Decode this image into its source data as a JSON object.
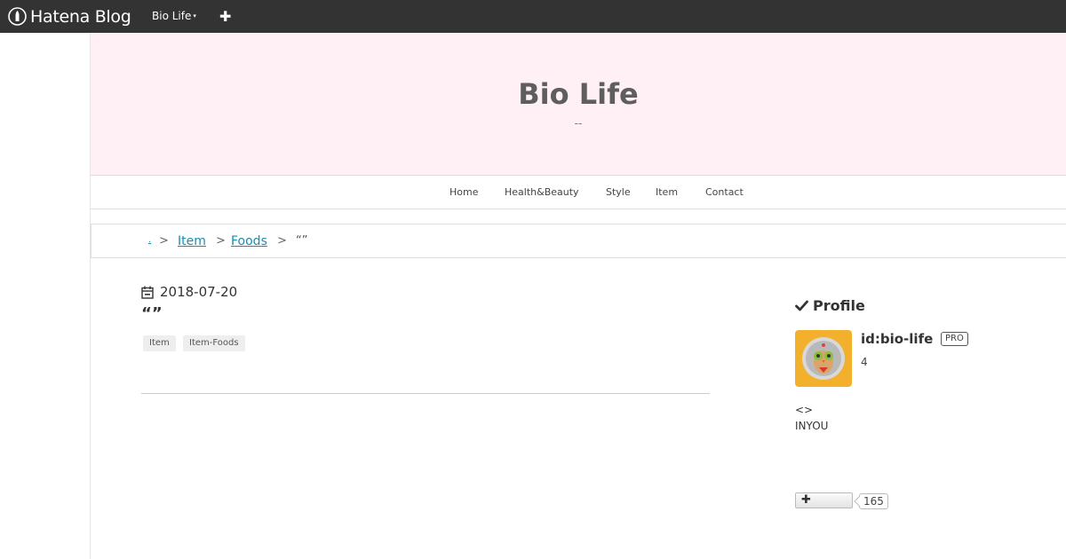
{
  "topbar": {
    "logo_text": "Hatena Blog",
    "blog_switch_label": "Bio Life",
    "caret": "▾",
    "add_label": "✚"
  },
  "header": {
    "title": "Bio Life",
    "description": "--"
  },
  "nav": {
    "items": [
      "Home",
      "Health&Beauty",
      "Style",
      "Item",
      "Contact"
    ]
  },
  "breadcrumb": {
    "home": ".",
    "sep": ">",
    "item": "Item",
    "foods": "Foods",
    "current": "“”"
  },
  "entry": {
    "date": "2018-07-20",
    "title": "“”",
    "tags": [
      "Item",
      "Item-Foods"
    ]
  },
  "profile": {
    "heading": "Profile",
    "id": "id:bio-life",
    "badge": "PRO",
    "count": "4",
    "desc1": "<>",
    "desc2": "INYOU"
  },
  "follow": {
    "plus": "✚",
    "count": "165"
  },
  "colors": {
    "topbar": "#333333",
    "header_bg": "#fff0f6",
    "link": "#1a8cae"
  }
}
